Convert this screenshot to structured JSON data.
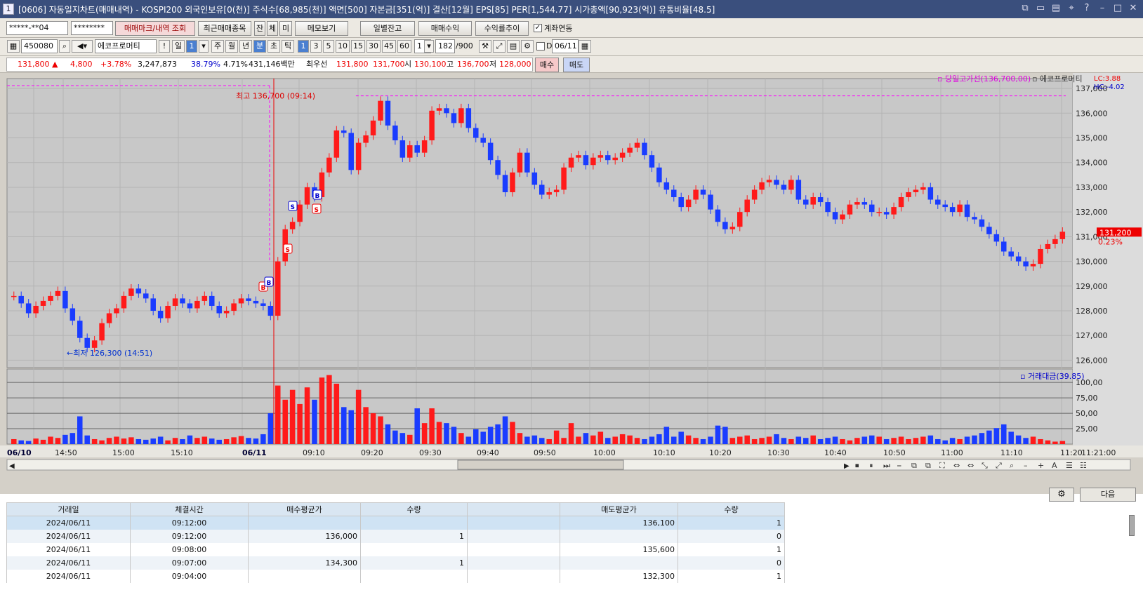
{
  "window": {
    "title": "[0606] 자동일지차트(매매내역) - KOSPI200 외국인보유[0(천)] 주식수[68,985(천)] 액면[500] 자본금[351(억)] 결산[12월] EPS[85] PER[1,544.77] 시가총액[90,923(억)] 유통비율[48.5]",
    "icon_label": "1"
  },
  "toolbar1": {
    "account": "*****-**04",
    "password": "********",
    "btn_trade_marks": "매매마크/내역 조회",
    "btn_recent": "최근매매종목",
    "btn_jan": "잔",
    "btn_che": "체",
    "btn_mi": "미",
    "btn_memo": "메모보기",
    "btn_daily": "일별잔고",
    "btn_profit": "매매수익",
    "btn_yield": "수익률추이",
    "chk_link": "계좌연동"
  },
  "toolbar2": {
    "code": "450080",
    "name": "에코프로머티",
    "period": [
      "일",
      "1",
      "주",
      "월",
      "년",
      "분",
      "초",
      "틱"
    ],
    "minutes": [
      "1",
      "3",
      "5",
      "10",
      "15",
      "30",
      "45",
      "60"
    ],
    "interval": "1",
    "count": "182",
    "max": "/900",
    "d_label": "D",
    "date": "06/11"
  },
  "quote": {
    "price": "131,800",
    "arrow": "▲",
    "change": "4,800",
    "rate": "+3.78%",
    "volume": "3,247,873",
    "ratio": "38.79%",
    "turnover": "4.71%",
    "amount": "431,146백만",
    "bid_label": "최우선",
    "bid1": "131,800",
    "bid2": "131,700",
    "open_label": "시",
    "open": "130,100",
    "high_label": "고",
    "high": "136,700",
    "low_label": "저",
    "low": "128,000",
    "buy_btn": "매수",
    "sell_btn": "매도"
  },
  "chart_data": {
    "type": "candlestick",
    "price_ticks": [
      "137,000",
      "136,000",
      "135,000",
      "134,000",
      "133,000",
      "132,000",
      "131,000",
      "130,000",
      "129,000",
      "128,000",
      "127,000",
      "126,000"
    ],
    "price_range": [
      125700,
      137400
    ],
    "vol_ticks": [
      "100,00",
      "75,00",
      "50,00",
      "25,00"
    ],
    "legend_high": "당일고가선(136,700,00)",
    "legend_name": "에코프로머티",
    "lc": "LC:3.88",
    "hc": "HC:-4.02",
    "cur_price": "131,200",
    "cur_pct": "0.23%",
    "max_label": "최고 136,700 (09:14)",
    "min_label": "최저 126,300 (14:51)",
    "vol_legend": "거래대금(39.85)",
    "x_labels": [
      "06/10",
      "14:50",
      "15:00",
      "15:10",
      "06/11",
      "09:10",
      "09:20",
      "09:30",
      "09:40",
      "09:50",
      "10:00",
      "10:10",
      "10:20",
      "10:30",
      "10:40",
      "10:50",
      "11:00",
      "11:10",
      "11:20",
      "11:21:00"
    ],
    "candles": [
      128.6,
      128.3,
      127.9,
      128.2,
      128.4,
      128.6,
      128.8,
      128.1,
      127.6,
      126.9,
      126.5,
      126.8,
      127.5,
      127.9,
      128.1,
      128.6,
      128.9,
      128.7,
      128.5,
      128.0,
      127.7,
      128.2,
      128.5,
      128.3,
      128.1,
      128.4,
      128.6,
      128.2,
      127.9,
      128.0,
      128.3,
      128.5,
      128.4,
      128.3,
      128.2,
      127.8,
      130.0,
      131.3,
      131.6,
      132.3,
      133.0,
      132.6,
      133.6,
      134.2,
      135.3,
      135.2,
      133.7,
      134.8,
      135.1,
      135.7,
      136.5,
      135.5,
      134.9,
      134.2,
      134.7,
      134.4,
      134.9,
      136.1,
      136.2,
      136.0,
      135.6,
      136.2,
      135.4,
      135.0,
      134.8,
      134.1,
      133.5,
      132.8,
      133.6,
      134.4,
      133.6,
      133.1,
      132.7,
      132.8,
      132.9,
      133.8,
      134.2,
      134.3,
      133.9,
      134.2,
      134.3,
      134.1,
      134.2,
      134.4,
      134.6,
      134.8,
      134.3,
      133.8,
      133.2,
      132.9,
      132.6,
      132.2,
      132.5,
      132.9,
      132.7,
      132.1,
      131.6,
      131.3,
      131.4,
      132.0,
      132.5,
      132.9,
      133.2,
      133.3,
      133.1,
      132.9,
      133.3,
      132.5,
      132.3,
      132.6,
      132.4,
      132.0,
      131.7,
      131.9,
      132.3,
      132.4,
      132.3,
      132.0,
      132.0,
      131.9,
      132.2,
      132.6,
      132.8,
      132.9,
      133.0,
      132.5,
      132.3,
      132.2,
      132.0,
      132.3,
      131.8,
      131.7,
      131.4,
      131.1,
      130.8,
      130.4,
      130.2,
      130.0,
      129.8,
      129.9,
      130.5,
      130.7,
      130.9,
      131.2
    ],
    "volumes": [
      8,
      6,
      5,
      9,
      7,
      12,
      10,
      15,
      18,
      45,
      14,
      8,
      6,
      10,
      12,
      9,
      11,
      8,
      7,
      9,
      12,
      6,
      10,
      8,
      14,
      10,
      12,
      9,
      7,
      8,
      11,
      13,
      10,
      9,
      16,
      50,
      95,
      72,
      88,
      65,
      92,
      72,
      108,
      112,
      98,
      60,
      55,
      88,
      60,
      50,
      45,
      32,
      22,
      18,
      15,
      58,
      34,
      58,
      36,
      34,
      28,
      18,
      12,
      24,
      20,
      28,
      32,
      45,
      36,
      18,
      12,
      14,
      10,
      8,
      22,
      10,
      34,
      12,
      18,
      14,
      20,
      10,
      12,
      16,
      14,
      10,
      8,
      12,
      16,
      28,
      12,
      20,
      14,
      10,
      8,
      12,
      30,
      28,
      10,
      12,
      14,
      8,
      10,
      12,
      16,
      10,
      8,
      12,
      10,
      14,
      8,
      10,
      12,
      8,
      6,
      10,
      12,
      14,
      12,
      8,
      10,
      12,
      8,
      10,
      12,
      14,
      8,
      6,
      10,
      8,
      12,
      14,
      18,
      22,
      26,
      32,
      20,
      14,
      10,
      12,
      8,
      6,
      4,
      5,
      5,
      5
    ],
    "trades": [
      {
        "type": "S",
        "idx": 39
      },
      {
        "type": "B",
        "idx": 38
      },
      {
        "type": "B",
        "idx": 42
      },
      {
        "type": "S",
        "idx": 44
      },
      {
        "type": "B",
        "idx": 48
      },
      {
        "type": "S",
        "idx": 48
      }
    ]
  },
  "scrollbar": {
    "left": "◀",
    "right": "▶"
  },
  "bottom_btn": {
    "gear": "⚙",
    "next": "다음"
  },
  "table": {
    "headers": [
      "거래일",
      "체결시간",
      "매수평균가",
      "수량",
      "",
      "매도평균가",
      "수량"
    ],
    "rows": [
      [
        "2024/06/11",
        "09:12:00",
        "",
        "",
        "",
        "136,100",
        "1"
      ],
      [
        "2024/06/11",
        "09:12:00",
        "136,000",
        "1",
        "",
        "",
        "0"
      ],
      [
        "2024/06/11",
        "09:08:00",
        "",
        "",
        "",
        "135,600",
        "1"
      ],
      [
        "2024/06/11",
        "09:07:00",
        "134,300",
        "1",
        "",
        "",
        "0"
      ],
      [
        "2024/06/11",
        "09:04:00",
        "",
        "",
        "",
        "132,300",
        "1"
      ]
    ]
  },
  "colors": {
    "up": "#ff1a1a",
    "down": "#1a3cff",
    "bg_chart": "#c8c8c8",
    "title_bar": "#3a4f7d",
    "high_line": "#ff00ff"
  }
}
